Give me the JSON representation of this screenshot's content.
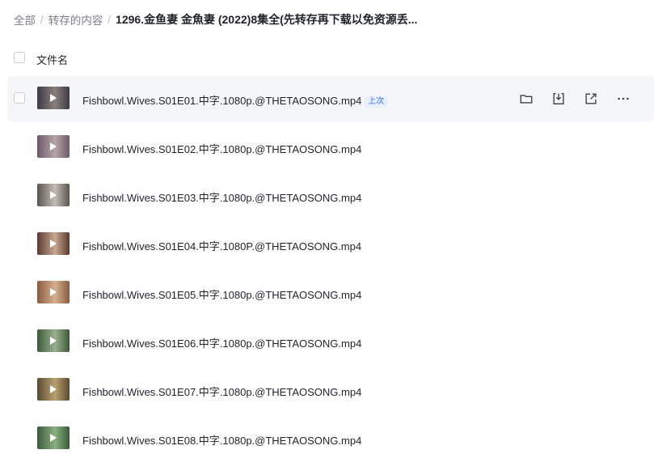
{
  "breadcrumb": {
    "items": [
      "全部",
      "转存的内容"
    ],
    "separator": "/",
    "current": "1296.金鱼妻 金魚妻 (2022)8集全(先转存再下载以免资源丢..."
  },
  "table": {
    "header_name": "文件名"
  },
  "files": [
    {
      "name": "Fishbowl.Wives.S01E01.中字.1080p.@THETAOSONG.mp4",
      "badge": "上次",
      "thumb_colors": [
        "#3c3a48",
        "#8a7f7a"
      ]
    },
    {
      "name": "Fishbowl.Wives.S01E02.中字.1080p.@THETAOSONG.mp4",
      "badge": "",
      "thumb_colors": [
        "#6a5a6a",
        "#b8a4a8"
      ]
    },
    {
      "name": "Fishbowl.Wives.S01E03.中字.1080p.@THETAOSONG.mp4",
      "badge": "",
      "thumb_colors": [
        "#5a5550",
        "#c4bcb4"
      ]
    },
    {
      "name": "Fishbowl.Wives.S01E04.中字.1080P.@THETAOSONG.mp4",
      "badge": "",
      "thumb_colors": [
        "#5a3a30",
        "#c8a890"
      ]
    },
    {
      "name": "Fishbowl.Wives.S01E05.中字.1080p.@THETAOSONG.mp4",
      "badge": "",
      "thumb_colors": [
        "#8a5a40",
        "#d4b090"
      ]
    },
    {
      "name": "Fishbowl.Wives.S01E06.中字.1080p.@THETAOSONG.mp4",
      "badge": "",
      "thumb_colors": [
        "#3a5a3a",
        "#9ab090"
      ]
    },
    {
      "name": "Fishbowl.Wives.S01E07.中字.1080p.@THETAOSONG.mp4",
      "badge": "",
      "thumb_colors": [
        "#5a4a30",
        "#b8a070"
      ]
    },
    {
      "name": "Fishbowl.Wives.S01E08.中字.1080p.@THETAOSONG.mp4",
      "badge": "",
      "thumb_colors": [
        "#3a5a3a",
        "#8ab080"
      ]
    }
  ],
  "row_actions": [
    "folder-icon",
    "download-icon",
    "share-icon",
    "more-icon"
  ],
  "colors": {
    "accent": "#3370ff",
    "hover_row": "#f5f6f7",
    "text": "#1f2329",
    "muted": "#7a7f87"
  }
}
